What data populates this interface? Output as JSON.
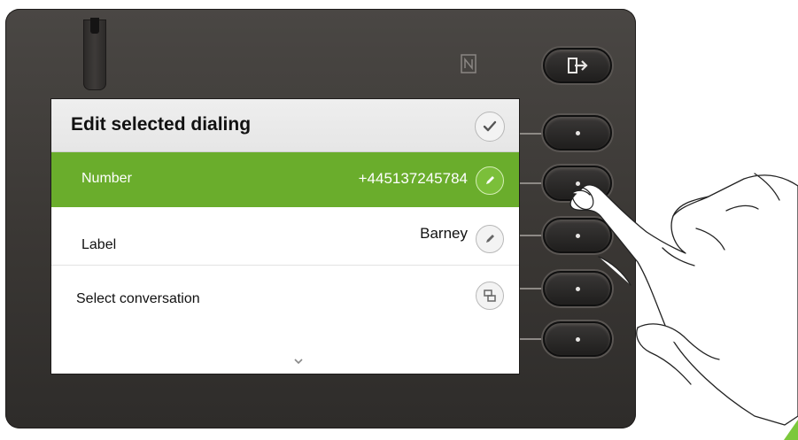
{
  "screen": {
    "title": "Edit selected dialing",
    "rows": [
      {
        "label": "Number",
        "value": "+445137245784",
        "selected": true,
        "icon": "pencil-icon"
      },
      {
        "label": "Label",
        "value": "Barney",
        "selected": false,
        "icon": "pencil-icon"
      },
      {
        "label": "Select conversation",
        "value": "",
        "selected": false,
        "icon": "conversation-icon"
      }
    ],
    "confirm_icon": "checkmark-icon",
    "scroll_indicator_icon": "chevron-down-icon"
  },
  "device": {
    "nfc_icon": "nfc-icon",
    "logout_icon": "logout-icon",
    "key_count": 5
  },
  "colors": {
    "accent_green": "#6aad2c",
    "device_body": "#3a3734",
    "title_bar": "#e6e6e6",
    "corner_mark": "#7cc83b"
  }
}
